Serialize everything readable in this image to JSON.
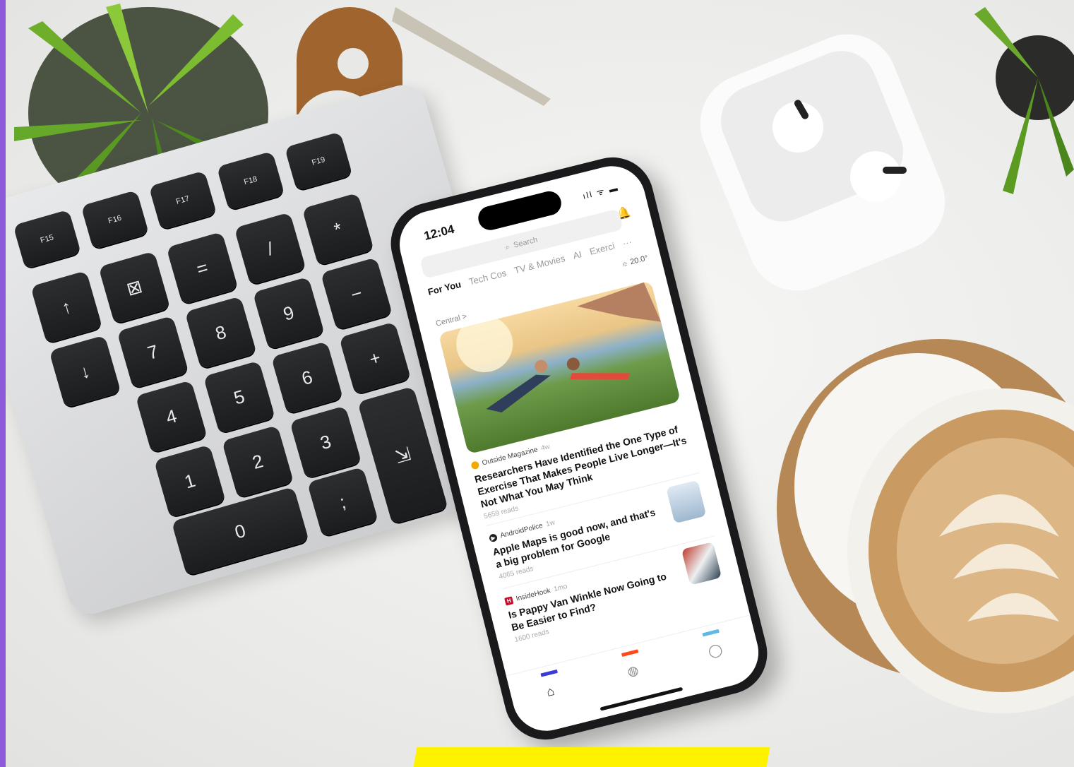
{
  "keyboard": {
    "keys": [
      "F15",
      "F16",
      "F17",
      "F18",
      "F19",
      "⊠",
      "=",
      "/",
      "*",
      "↑",
      "−",
      "7",
      "8",
      "9",
      "+",
      "↓",
      "4",
      "5",
      "6",
      "1",
      "2",
      "3",
      "0",
      ";",
      "⇲",
      "▲",
      "▼",
      "▶",
      "⤓"
    ]
  },
  "phone": {
    "status": {
      "time": "12:04",
      "icons": "ıll ᯤ ▬"
    },
    "search_placeholder": "Search",
    "bell_icon": "🔔",
    "tabs": [
      "For You",
      "Tech Cos",
      "TV & Movies",
      "AI",
      "Exerci"
    ],
    "tabs_more": "···",
    "weather": "☼ 20.0°",
    "region": "Central  >",
    "articles": [
      {
        "source": "Outside Magazine",
        "age": "4w",
        "headline": "Researchers Have Identified the One Type of Exercise That Makes People Live Longer—It's Not What You May Think",
        "reads": "5659 reads",
        "icon_color": "#f2a900"
      },
      {
        "source": "AndroidPolice",
        "age": "1w",
        "headline": "Apple Maps is good now, and that's a big problem for Google",
        "reads": "4065 reads",
        "icon_color": "#222"
      },
      {
        "source": "InsideHook",
        "age": "1mo",
        "headline": "Is Pappy Van Winkle Now Going to Be Easier to Find?",
        "reads": "1600 reads",
        "icon_color": "#c8102e"
      }
    ],
    "nav": {
      "home_icon": "⌂",
      "globe_icon": "◍",
      "profile_icon": "◯"
    },
    "nav_colors": [
      "#3b3bd6",
      "#ff4a1c",
      "#5fb8e6"
    ]
  },
  "colors": {
    "edge": "#8d5ad9",
    "highlight": "#fff200"
  }
}
